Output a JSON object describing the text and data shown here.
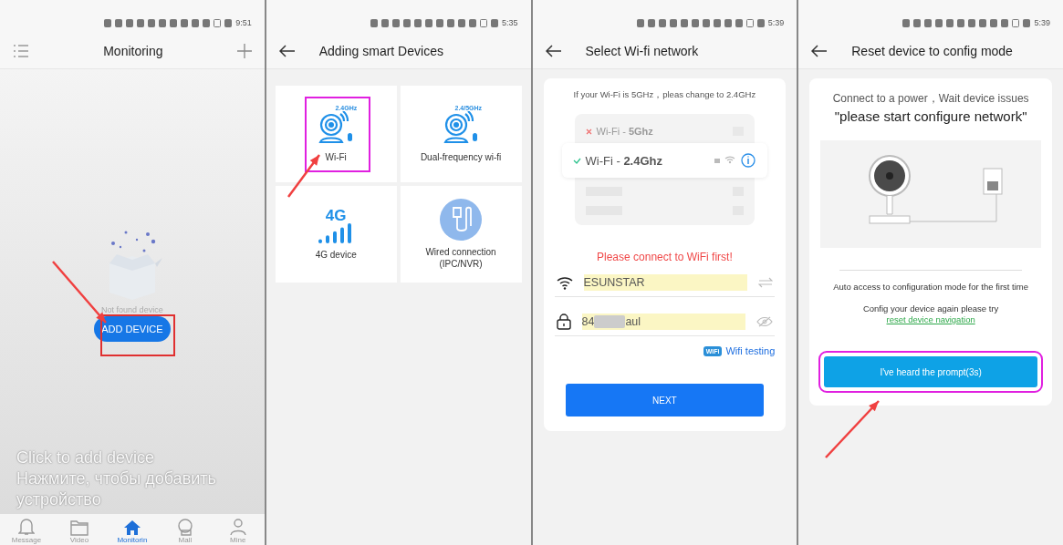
{
  "monitoring_screen": {
    "status_time": "9:51",
    "title": "Monitoring",
    "empty_text": "Not found device",
    "add_button": "ADD DEVICE",
    "caption": [
      "Click to add device",
      "Нажмите, чтобы добавить устройство"
    ],
    "nav": [
      {
        "kind": "bell",
        "label": "Message",
        "selected": false
      },
      {
        "kind": "folder",
        "label": "Video",
        "selected": false
      },
      {
        "kind": "home",
        "label": "Monitorin",
        "selected": true
      },
      {
        "kind": "mall",
        "label": "Mall",
        "selected": false
      },
      {
        "kind": "person",
        "label": "Mine",
        "selected": false
      }
    ]
  },
  "add_device_screen": {
    "status_time": "5:35",
    "title": "Adding smart Devices",
    "options": [
      {
        "kind": "camera",
        "badge": "2.4GHz",
        "label": "Wi-Fi"
      },
      {
        "kind": "camera",
        "badge": "2.4/5GHz",
        "label": "Dual-frequency wi-fi"
      },
      {
        "kind": "cellular",
        "badge": "4G",
        "label": "4G device"
      },
      {
        "kind": "wired",
        "label": "Wired connection (IPC/NVR)"
      }
    ]
  },
  "wifi_screen": {
    "status_time": "5:39",
    "title": "Select Wi-fi network",
    "hint": "If your Wi-Fi is 5GHz，pleas change to 2.4GHz",
    "networks": [
      {
        "label": "Wi-Fi - **5Ghz**",
        "selected": false
      },
      {
        "label": "Wi-Fi - **2.4Ghz**",
        "selected": true
      }
    ],
    "warning": "Please connect to WiFi first!",
    "ssid": "ESUNSTAR",
    "password_start": "84",
    "password_end": "aul",
    "wifi_badge": "WiFi",
    "wifi_testing": "Wifi testing",
    "next": "NEXT"
  },
  "reset_screen": {
    "status_time": "5:39",
    "title": "Reset device to config mode",
    "instruction": "Connect to a power，Wait device issues",
    "quote": "\"please start configure network\"",
    "auto_note": "Auto access to configuration mode for the first time",
    "retry_text": "Config your device again please try ",
    "retry_link": "reset device navigation",
    "confirm": "I've heard the prompt(3s)"
  }
}
